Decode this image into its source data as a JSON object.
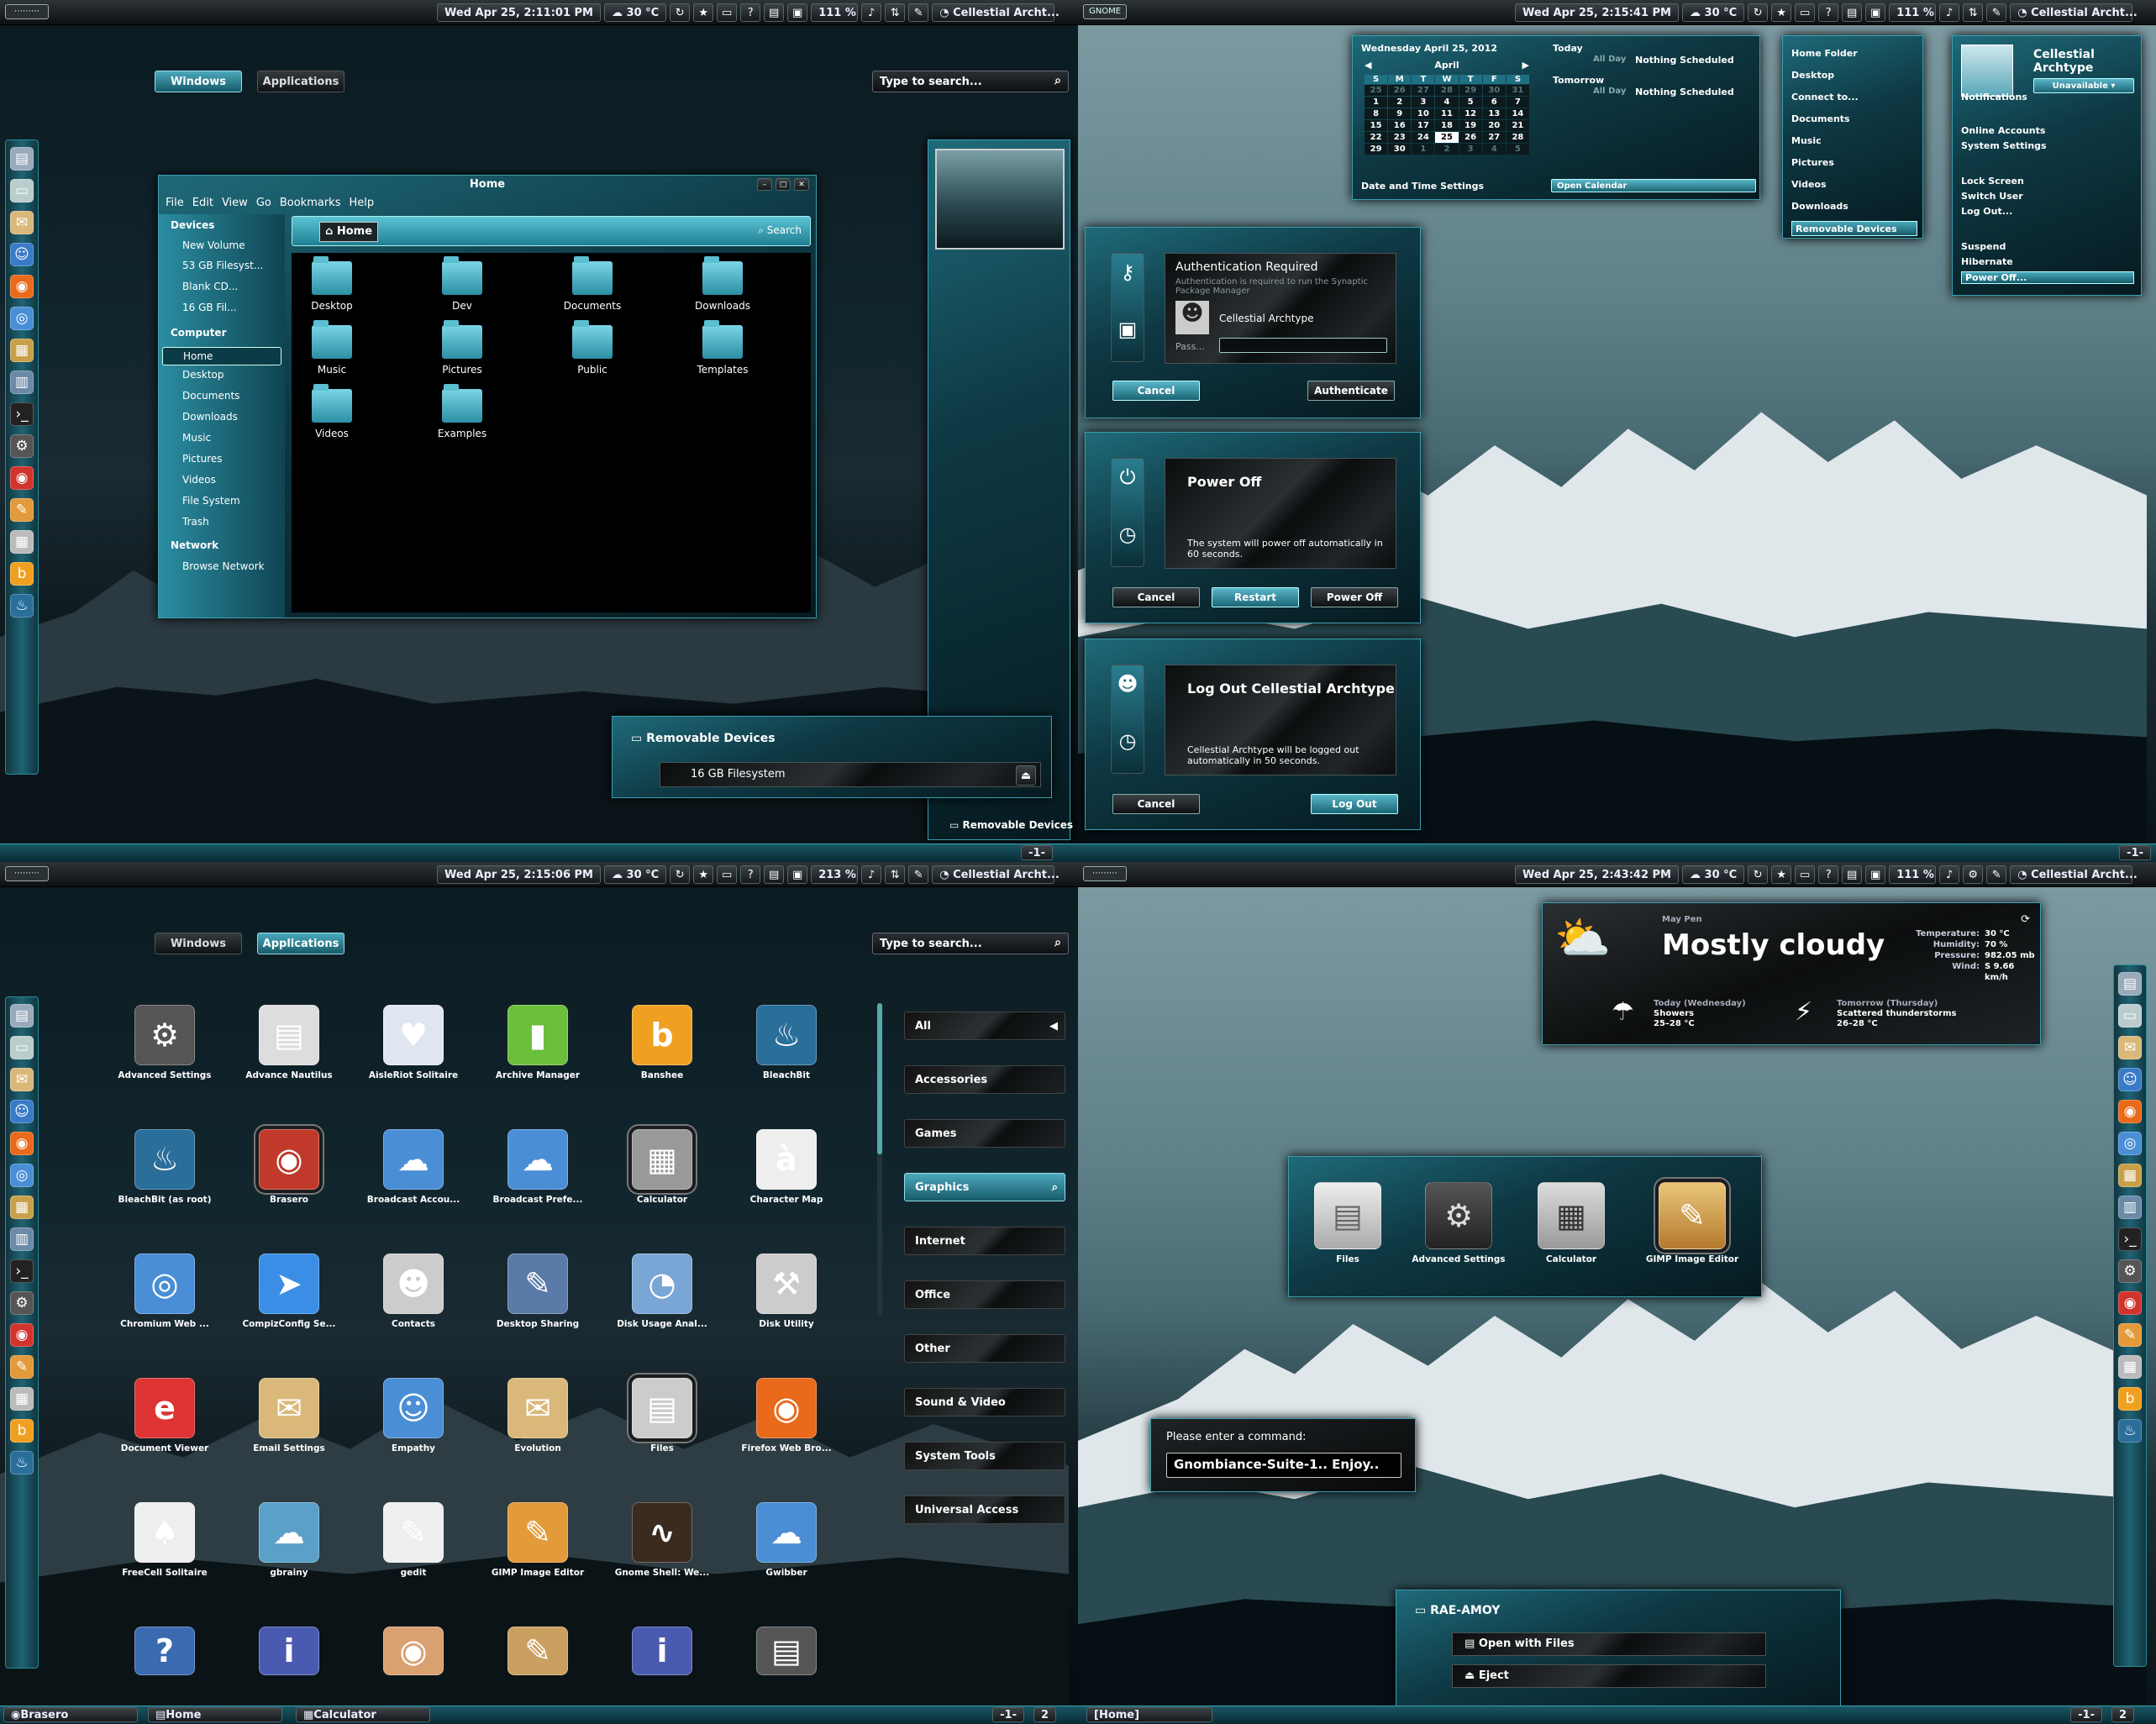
{
  "q1": {
    "clock": "Wed Apr 25, 2:11:01 PM",
    "weather": "30 °C",
    "bat_a": "1",
    "bat_b": "11 %",
    "user": "Cellestial  Archt...",
    "tab_windows": "Windows",
    "tab_apps": "Applications",
    "search_placeholder": "Type to search...",
    "nautilus": {
      "title": "Home",
      "menu": [
        "File",
        "Edit",
        "View",
        "Go",
        "Bookmarks",
        "Help"
      ],
      "location": "Home",
      "search": "Search",
      "sidebar": {
        "devices_header": "Devices",
        "devices": [
          "New Volume",
          "53 GB Filesyst...",
          "Blank CD...",
          "16 GB Fil..."
        ],
        "computer_header": "Computer",
        "computer": [
          "Home",
          "Desktop",
          "Documents",
          "Downloads",
          "Music",
          "Pictures",
          "Videos",
          "File System",
          "Trash"
        ],
        "network_header": "Network",
        "network": [
          "Browse Network"
        ]
      },
      "files": [
        "Desktop",
        "Dev",
        "Documents",
        "Downloads",
        "Music",
        "Pictures",
        "Public",
        "Templates",
        "Videos",
        "Examples"
      ]
    },
    "removable": {
      "title": "Removable Devices",
      "device": "16 GB Filesystem"
    },
    "tray_label": "Removable Devices",
    "workspace": "-1-"
  },
  "q2": {
    "logo": "GNOME",
    "clock": "Wed Apr 25, 2:15:41 PM",
    "weather": "30 °C",
    "bat_a": "1",
    "bat_b": "11 %",
    "user": "Cellestial  Archt...",
    "calendar": {
      "date_line": "Wednesday April 25, 2012",
      "month": "April",
      "days": [
        "S",
        "M",
        "T",
        "W",
        "T",
        "F",
        "S"
      ],
      "rows": [
        [
          "25",
          "26",
          "27",
          "28",
          "29",
          "30",
          "31"
        ],
        [
          "1",
          "2",
          "3",
          "4",
          "5",
          "6",
          "7"
        ],
        [
          "8",
          "9",
          "10",
          "11",
          "12",
          "13",
          "14"
        ],
        [
          "15",
          "16",
          "17",
          "18",
          "19",
          "20",
          "21"
        ],
        [
          "22",
          "23",
          "24",
          "25",
          "26",
          "27",
          "28"
        ],
        [
          "29",
          "30",
          "1",
          "2",
          "3",
          "4",
          "5"
        ]
      ],
      "today": "Today",
      "tomorrow": "Tomorrow",
      "all_day": "All Day",
      "nothing": "Nothing Scheduled",
      "settings": "Date and Time Settings",
      "open": "Open Calendar"
    },
    "places": [
      "Home Folder",
      "Desktop",
      "Connect to...",
      "Documents",
      "Music",
      "Pictures",
      "Videos",
      "Downloads",
      "Removable Devices"
    ],
    "usermenu": {
      "name": "Cellestial\nArchtype",
      "status": "Unavailable",
      "items": [
        "Notifications",
        "Online Accounts",
        "System Settings",
        "Lock Screen",
        "Switch User",
        "Log Out...",
        "Suspend",
        "Hibernate",
        "Power Off..."
      ]
    },
    "auth": {
      "title": "Authentication Required",
      "msg": "Authentication is required to run the Synaptic Package Manager",
      "user": "Cellestial   Archtype",
      "pass": "Pass...",
      "cancel": "Cancel",
      "ok": "Authenticate"
    },
    "power": {
      "title": "Power Off",
      "msg": "The system will power off automatically in 60 seconds.",
      "cancel": "Cancel",
      "restart": "Restart",
      "off": "Power Off"
    },
    "logout": {
      "title": "Log Out Cellestial   Archtype",
      "msg": "Cellestial   Archtype will be logged out automatically in 50 seconds.",
      "cancel": "Cancel",
      "ok": "Log Out"
    },
    "workspace": "-1-"
  },
  "q3": {
    "clock": "Wed Apr 25, 2:15:06 PM",
    "weather": "30 °C",
    "bat_a": "2",
    "bat_b": "13 %",
    "user": "Cellestial  Archt...",
    "tab_windows": "Windows",
    "tab_apps": "Applications",
    "search_placeholder": "Type to search...",
    "apps": [
      "Advanced Settings",
      "Advance Nautilus",
      "AisleRiot Solitaire",
      "Archive Manager",
      "Banshee",
      "BleachBit",
      "BleachBit (as root)",
      "Brasero",
      "Broadcast Accou...",
      "Broadcast Prefe...",
      "Calculator",
      "Character Map",
      "Chromium Web ...",
      "CompizConfig Se...",
      "Contacts",
      "Desktop Sharing",
      "Disk Usage Anal...",
      "Disk Utility",
      "Document Viewer",
      "Email Settings",
      "Empathy",
      "Evolution",
      "Files",
      "Firefox Web Bro...",
      "FreeCell Solitaire",
      "gbrainy",
      "gedit",
      "GIMP Image Editor",
      "Gnome Shell: We...",
      "Gwibber"
    ],
    "categories": [
      "All",
      "Accessories",
      "Games",
      "Graphics",
      "Internet",
      "Office",
      "Other",
      "Sound & Video",
      "System Tools",
      "Universal Access"
    ],
    "taskbar": [
      "Brasero",
      "Home",
      "Calculator"
    ],
    "workspace_a": "-1-",
    "workspace_b": "2"
  },
  "q4": {
    "clock": "Wed Apr 25, 2:43:42 PM",
    "weather": "30 °C",
    "bat_a": "1",
    "bat_b": "11 %",
    "user": "Cellestial  Archt...",
    "weather_widget": {
      "location": "May Pen",
      "condition": "Mostly cloudy",
      "temperature_label": "Temperature:",
      "temperature": "30 °C",
      "humidity_label": "Humidity:",
      "humidity": "70 %",
      "pressure_label": "Pressure:",
      "pressure": "982.05 mb",
      "wind_label": "Wind:",
      "wind": "S 9.66 km/h",
      "today_label": "Today (Wednesday)",
      "today_cond": "Showers",
      "today_temp": "25–28 °C",
      "tomorrow_label": "Tomorrow (Thursday)",
      "tomorrow_cond": "Scattered thunderstorms",
      "tomorrow_temp": "26–28 °C"
    },
    "switcher": [
      "Files",
      "Advanced Settings",
      "Calculator",
      "GIMP Image Editor"
    ],
    "run": {
      "prompt": "Please enter a command:",
      "value": "Gnombiance-Suite-1.. Enjoy.."
    },
    "device": {
      "name": "RAE-AMOY",
      "open": "Open with Files",
      "eject": "Eject"
    },
    "taskbar": "[Home]",
    "workspace_a": "-1-",
    "workspace_b": "2"
  }
}
